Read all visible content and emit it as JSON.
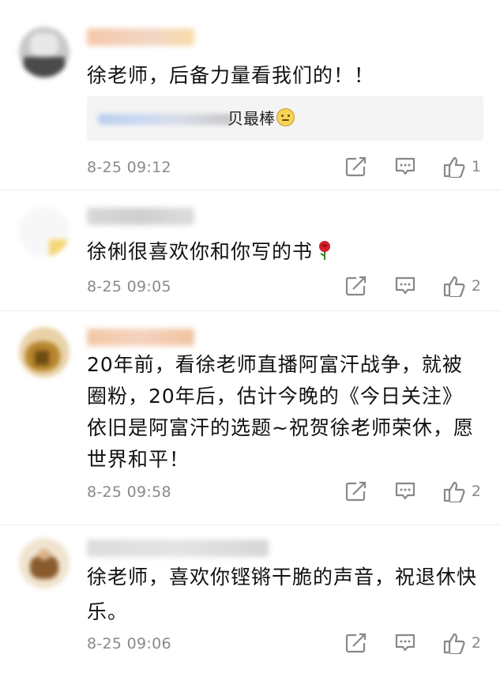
{
  "comments": [
    {
      "text": "徐老师，后备力量看我们的！！",
      "reply": {
        "text": "贝最棒"
      },
      "time": "8-25 09:12",
      "likes": "1"
    },
    {
      "text": "徐俐很喜欢你和你写的书",
      "time": "8-25 09:05",
      "likes": "2"
    },
    {
      "text_lines": [
        "20年前，看徐老师直播阿富汗战争，就被",
        "圈粉，20年后，估计今晚的《今日关注》",
        "依旧是阿富汗的选题~祝贺徐老师荣休，愿",
        "世界和平！"
      ],
      "time": "8-25 09:58",
      "likes": "2"
    },
    {
      "text_lines": [
        "徐老师，喜欢你铿锵干脆的声音，祝退休快",
        "乐。"
      ],
      "time": "8-25 09:06",
      "likes": "2"
    }
  ],
  "icons": {
    "share": "share-icon",
    "comment": "comment-icon",
    "like": "like-icon"
  }
}
